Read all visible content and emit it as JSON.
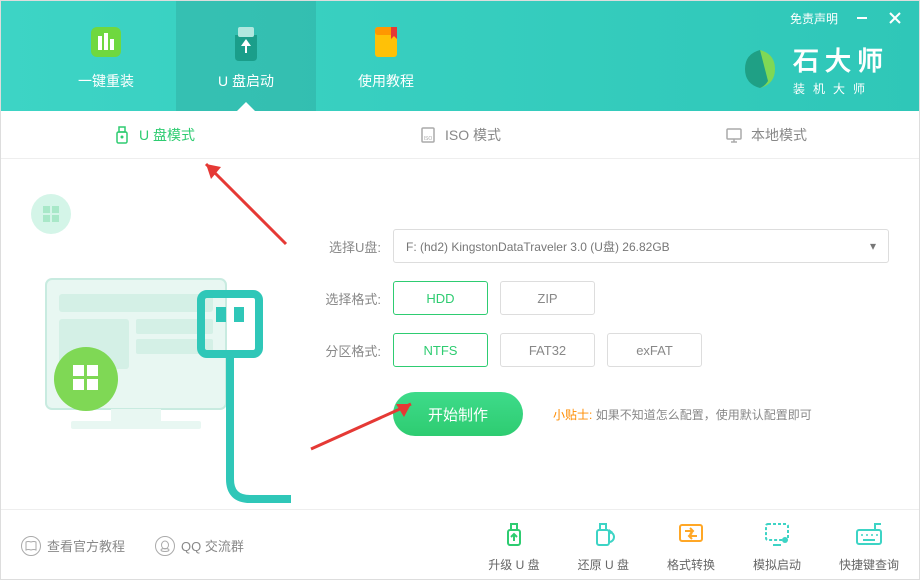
{
  "header": {
    "disclaimer": "免责声明",
    "tabs": [
      {
        "label": "一键重装",
        "active": false
      },
      {
        "label": "U 盘启动",
        "active": true
      },
      {
        "label": "使用教程",
        "active": false
      }
    ],
    "brand_title": "石大师",
    "brand_subtitle": "装机大师"
  },
  "mode_tabs": [
    {
      "label": "U 盘模式",
      "active": true
    },
    {
      "label": "ISO 模式",
      "active": false
    },
    {
      "label": "本地模式",
      "active": false
    }
  ],
  "form": {
    "disk_label": "选择U盘:",
    "disk_value": "F: (hd2) KingstonDataTraveler 3.0 (U盘) 26.82GB",
    "format_label": "选择格式:",
    "format_options": [
      {
        "label": "HDD",
        "selected": true
      },
      {
        "label": "ZIP",
        "selected": false
      }
    ],
    "partition_label": "分区格式:",
    "partition_options": [
      {
        "label": "NTFS",
        "selected": true
      },
      {
        "label": "FAT32",
        "selected": false
      },
      {
        "label": "exFAT",
        "selected": false
      }
    ],
    "primary_button": "开始制作",
    "tip_label": "小贴士:",
    "tip_text": "如果不知道怎么配置，使用默认配置即可"
  },
  "footer": {
    "links": [
      {
        "label": "查看官方教程"
      },
      {
        "label": "QQ 交流群"
      }
    ],
    "tools": [
      {
        "label": "升级 U 盘"
      },
      {
        "label": "还原 U 盘"
      },
      {
        "label": "格式转换"
      },
      {
        "label": "模拟启动"
      },
      {
        "label": "快捷键查询"
      }
    ]
  }
}
